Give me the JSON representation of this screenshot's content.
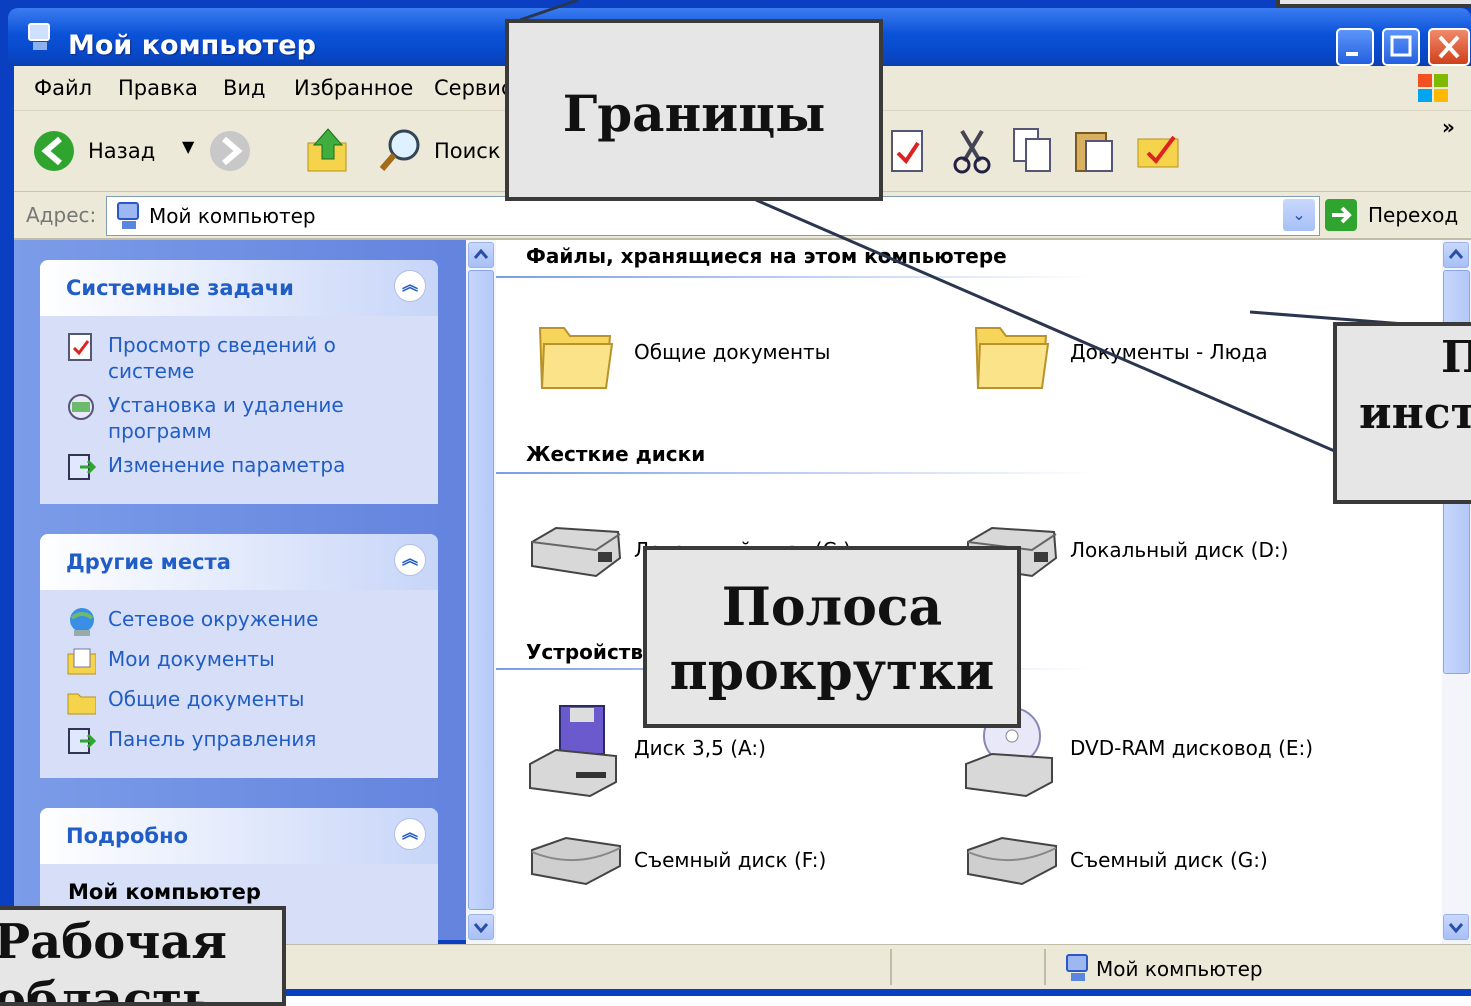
{
  "window": {
    "title": "Мой компьютер"
  },
  "menubar": {
    "items": [
      "Файл",
      "Правка",
      "Вид",
      "Избранное",
      "Сервис"
    ]
  },
  "toolbar": {
    "back_label": "Назад",
    "search_label": "Поиск",
    "more_label": "»"
  },
  "addressbar": {
    "label": "Адрес:",
    "value": "Мой компьютер",
    "go_label": "Переход"
  },
  "sidebar": {
    "system_tasks": {
      "title": "Системные задачи",
      "items": [
        {
          "label_1": "Просмотр сведений о",
          "label_2": "системе",
          "icon": "system-info-icon"
        },
        {
          "label_1": "Установка и удаление",
          "label_2": "программ",
          "icon": "add-remove-programs-icon"
        },
        {
          "label_1": "Изменение параметра",
          "label_2": "",
          "icon": "control-panel-icon"
        }
      ]
    },
    "other_places": {
      "title": "Другие места",
      "items": [
        {
          "label": "Сетевое окружение",
          "icon": "network-icon"
        },
        {
          "label": "Мои документы",
          "icon": "my-documents-icon"
        },
        {
          "label": "Общие документы",
          "icon": "folder-icon"
        },
        {
          "label": "Панель управления",
          "icon": "control-panel-icon"
        }
      ]
    },
    "details": {
      "title": "Подробно",
      "name": "Мой компьютер"
    }
  },
  "content": {
    "groups": [
      {
        "heading": "Файлы, хранящиеся на этом компьютере",
        "items": [
          {
            "label": "Общие документы",
            "icon": "folder-icon"
          },
          {
            "label": "Документы - Люда",
            "icon": "folder-icon"
          }
        ]
      },
      {
        "heading": "Жесткие диски",
        "items": [
          {
            "label": "Локальный диск (C:)",
            "icon": "hard-disk-icon"
          },
          {
            "label": "Локальный диск (D:)",
            "icon": "hard-disk-icon"
          }
        ]
      },
      {
        "heading": "Устройства со съемными носителями",
        "items": [
          {
            "label": "Диск 3,5 (A:)",
            "icon": "floppy-drive-icon"
          },
          {
            "label": "DVD-RAM дисковод (E:)",
            "icon": "dvd-drive-icon"
          },
          {
            "label": "Съемный диск (F:)",
            "icon": "removable-disk-icon"
          },
          {
            "label": "Съемный диск (G:)",
            "icon": "removable-disk-icon"
          }
        ]
      }
    ]
  },
  "statusbar": {
    "text": "Мой компьютер"
  },
  "callouts": {
    "borders": "Границы",
    "scrollbar_1": "Полоса",
    "scrollbar_2": "прокрутки",
    "toolbar_1": "Панель",
    "toolbar_2": "инструментов",
    "workarea_1": "Рабочая",
    "workarea_2": "область"
  },
  "colors": {
    "titlebar": "#0a52d8",
    "link_blue": "#215dc6",
    "pane_blue": "#7b9ce8",
    "callout_bg": "#e6e6e6"
  }
}
